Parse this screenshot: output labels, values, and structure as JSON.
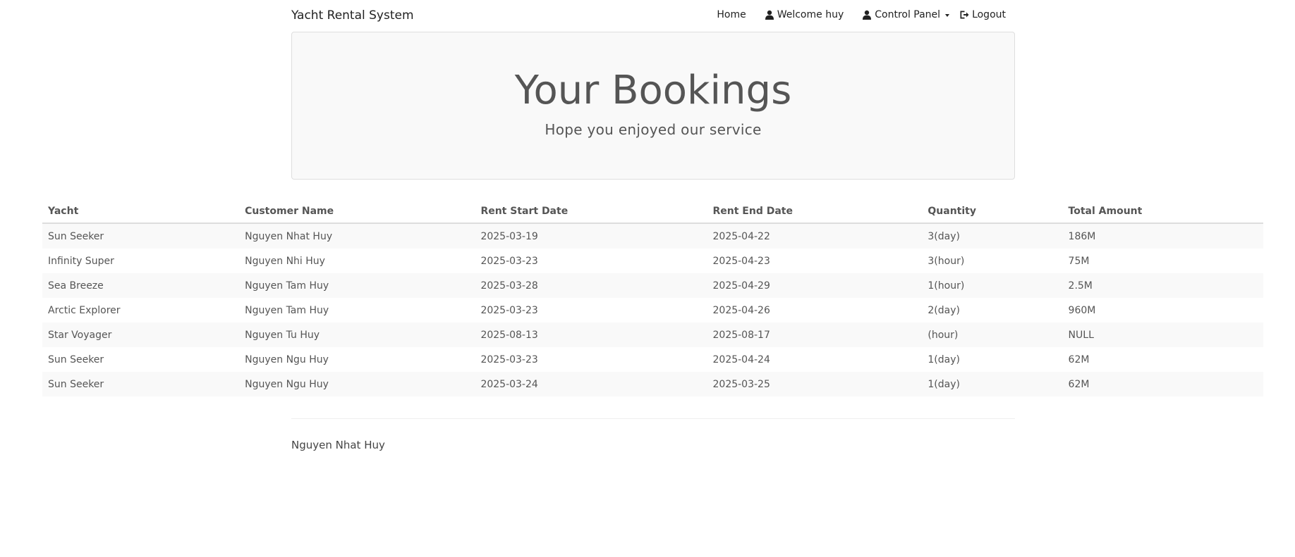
{
  "navbar": {
    "brand": "Yacht Rental System",
    "home": "Home",
    "welcome": "Welcome huy",
    "control_panel": "Control Panel",
    "logout": "Logout",
    "icons": {
      "welcome": "user-icon",
      "control_panel": "user-icon",
      "logout": "log-out-icon"
    }
  },
  "jumbotron": {
    "title": "Your Bookings",
    "subtitle": "Hope you enjoyed our service"
  },
  "table": {
    "headers": [
      "Yacht",
      "Customer Name",
      "Rent Start Date",
      "Rent End Date",
      "Quantity",
      "Total Amount"
    ],
    "rows": [
      [
        "Sun Seeker",
        "Nguyen Nhat Huy",
        "2025-03-19",
        "2025-04-22",
        "3(day)",
        "186M"
      ],
      [
        "Infinity Super",
        "Nguyen Nhi Huy",
        "2025-03-23",
        "2025-04-23",
        "3(hour)",
        "75M"
      ],
      [
        "Sea Breeze",
        "Nguyen Tam Huy",
        "2025-03-28",
        "2025-04-29",
        "1(hour)",
        "2.5M"
      ],
      [
        "Arctic Explorer",
        "Nguyen Tam Huy",
        "2025-03-23",
        "2025-04-26",
        "2(day)",
        "960M"
      ],
      [
        "Star Voyager",
        "Nguyen Tu Huy",
        "2025-08-13",
        "2025-08-17",
        "(hour)",
        "NULL"
      ],
      [
        "Sun Seeker",
        "Nguyen Ngu Huy",
        "2025-03-23",
        "2025-04-24",
        "1(day)",
        "62M"
      ],
      [
        "Sun Seeker",
        "Nguyen Ngu Huy",
        "2025-03-24",
        "2025-03-25",
        "1(day)",
        "62M"
      ]
    ]
  },
  "footer": {
    "text": "Nguyen Nhat Huy"
  }
}
